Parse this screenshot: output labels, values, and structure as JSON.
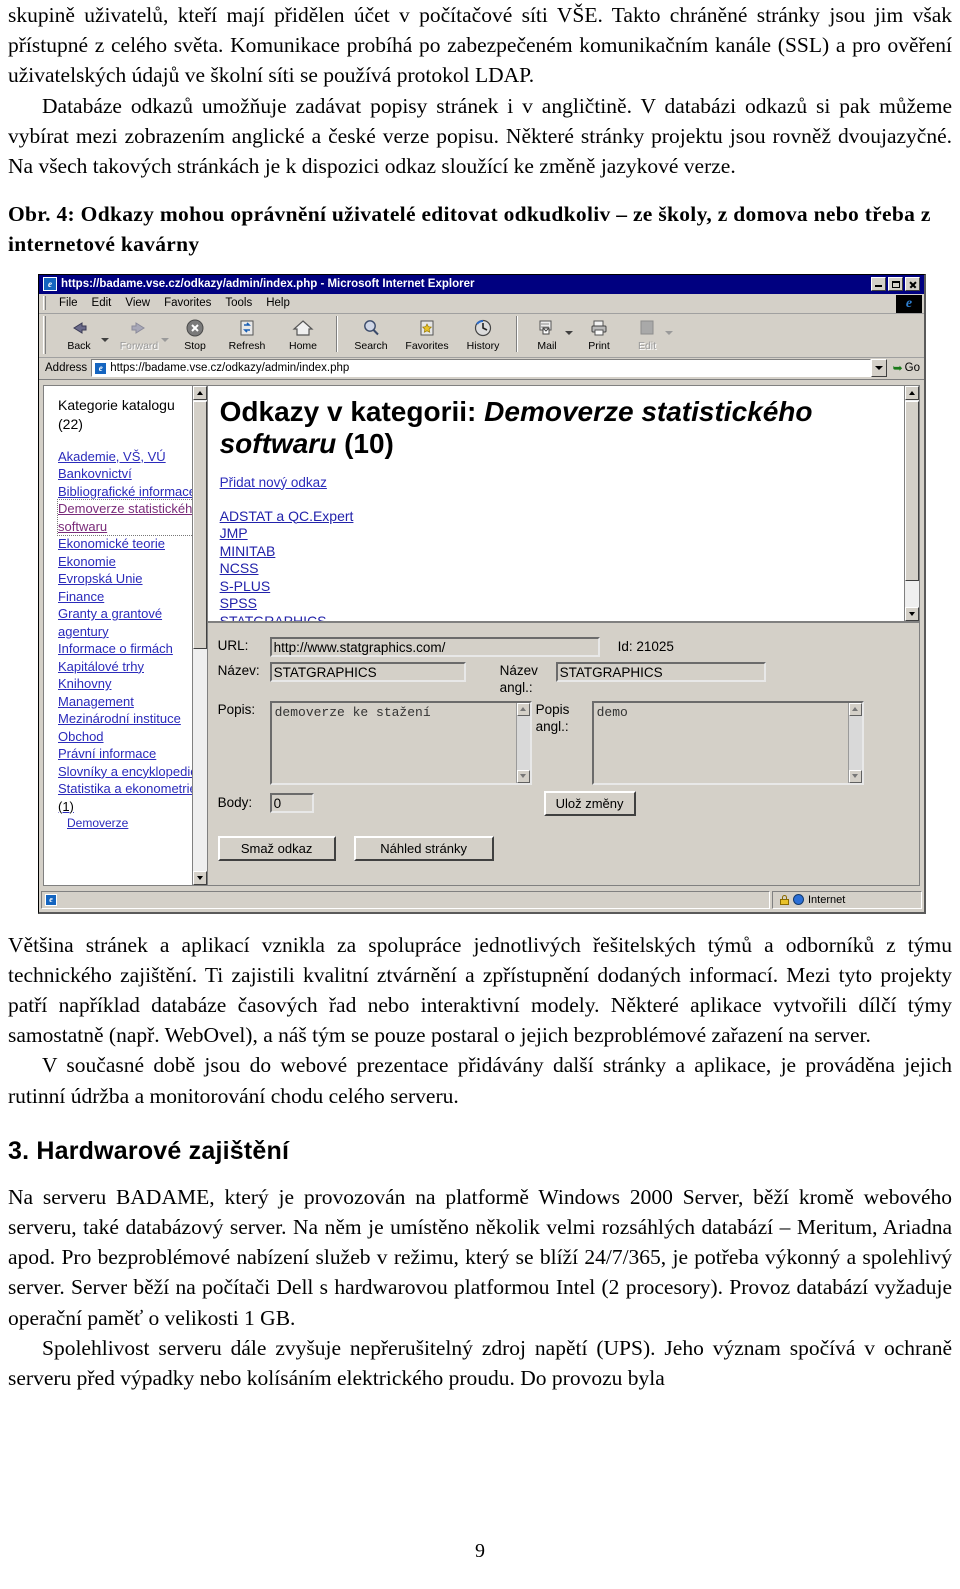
{
  "document": {
    "paragraphs": [
      "skupině uživatelů, kteří mají přidělen účet v počítačové síti VŠE. Takto chráněné stránky jsou jim však přístupné z celého světa. Komunikace probíhá po zabezpečeném komunikačním kanále (SSL) a pro ověření uživatelských údajů ve školní síti se používá protokol LDAP.",
      "Databáze odkazů umožňuje zadávat popisy stránek i v angličtině. V databázi odkazů si pak můžeme vybírat mezi zobrazením anglické a české verze popisu. Některé stránky projektu jsou rovněž dvoujazyčné. Na všech takových stránkách je k dispozici odkaz sloužící ke změně jazykové verze."
    ],
    "figure_caption": "Obr. 4: Odkazy mohou oprávnění uživatelé editovat odkudkoliv – ze školy, z domova nebo třeba z internetové kavárny",
    "paragraphs_after": [
      "Většina stránek a aplikací vznikla za spolupráce jednotlivých řešitelských týmů a odborníků z týmu technického zajištění. Ti zajistili kvalitní ztvárnění a zpřístupnění dodaných informací. Mezi tyto projekty patří například databáze časových řad nebo interaktivní modely. Některé aplikace vytvořili dílčí týmy samostatně (např. WebOvel), a náš tým se pouze postaral o jejich bezproblémové zařazení na server.",
      "V současné době jsou do webové prezentace přidávány další stránky a aplikace, je prováděna jejich rutinní údržba a monitorování chodu celého serveru."
    ],
    "section_heading": "3. Hardwarové zajištění",
    "paragraphs_section": [
      "Na serveru BADAME, který je provozován na platformě Windows 2000 Server, běží kromě webového serveru, také databázový server. Na něm je umístěno několik velmi rozsáhlých databází – Meritum, Ariadna apod. Pro bezproblémové nabízení služeb v režimu, který se blíží 24/7/365, je potřeba výkonný a spolehlivý server. Server běží na počítači Dell s hardwarovou platformou Intel (2 procesory). Provoz databází vyžaduje operační paměť o velikosti 1 GB.",
      "Spolehlivost serveru dále zvyšuje nepřerušitelný zdroj napětí (UPS). Jeho význam spočívá v ochraně serveru před výpadky nebo kolísáním elektrického proudu. Do provozu byla"
    ],
    "page_number": "9"
  },
  "browser": {
    "title": "https://badame.vse.cz/odkazy/admin/index.php - Microsoft Internet Explorer",
    "titlebar_icon": "e",
    "window_buttons": [
      "minimize",
      "maximize",
      "close"
    ],
    "menu": [
      "File",
      "Edit",
      "View",
      "Favorites",
      "Tools",
      "Help"
    ],
    "toolbar": [
      {
        "label": "Back",
        "icon": "back-arrow-icon",
        "dropdown": true,
        "disabled": false
      },
      {
        "label": "Forward",
        "icon": "forward-arrow-icon",
        "dropdown": true,
        "disabled": true
      },
      {
        "label": "Stop",
        "icon": "stop-icon",
        "dropdown": false,
        "disabled": false
      },
      {
        "label": "Refresh",
        "icon": "refresh-icon",
        "dropdown": false,
        "disabled": false
      },
      {
        "label": "Home",
        "icon": "home-icon",
        "dropdown": false,
        "disabled": false
      },
      {
        "label": "Search",
        "icon": "search-icon",
        "dropdown": false,
        "disabled": false
      },
      {
        "label": "Favorites",
        "icon": "favorites-icon",
        "dropdown": false,
        "disabled": false
      },
      {
        "label": "History",
        "icon": "history-icon",
        "dropdown": false,
        "disabled": false
      },
      {
        "label": "Mail",
        "icon": "mail-icon",
        "dropdown": true,
        "disabled": false
      },
      {
        "label": "Print",
        "icon": "print-icon",
        "dropdown": false,
        "disabled": false
      },
      {
        "label": "Edit",
        "icon": "edit-icon",
        "dropdown": true,
        "disabled": true
      }
    ],
    "address": {
      "label": "Address",
      "value": "https://badame.vse.cz/odkazy/admin/index.php",
      "go_label": "Go"
    },
    "statusbar": {
      "message": "",
      "zone": "Internet"
    }
  },
  "sidebar": {
    "title": "Kategorie katalogu (22)",
    "items": [
      {
        "label": "Akademie, VŠ, VÚ",
        "state": "link",
        "count": ""
      },
      {
        "label": "Bankovnictví",
        "state": "link",
        "count": ""
      },
      {
        "label": "Bibliografické informace",
        "state": "link",
        "count": ""
      },
      {
        "label": "Demoverze statistického softwaru",
        "state": "visited-focused",
        "count": ""
      },
      {
        "label": "Ekonomické teorie",
        "state": "link",
        "count": ""
      },
      {
        "label": "Ekonomie",
        "state": "link",
        "count": ""
      },
      {
        "label": "Evropská Unie",
        "state": "link",
        "count": ""
      },
      {
        "label": "Finance",
        "state": "link",
        "count": ""
      },
      {
        "label": "Granty a grantové agentury",
        "state": "link",
        "count": ""
      },
      {
        "label": "Informace o firmách",
        "state": "link",
        "count": ""
      },
      {
        "label": "Kapitálové trhy",
        "state": "link",
        "count": ""
      },
      {
        "label": "Knihovny",
        "state": "link",
        "count": ""
      },
      {
        "label": "Management",
        "state": "link",
        "count": ""
      },
      {
        "label": "Mezinárodní instituce",
        "state": "link",
        "count": ""
      },
      {
        "label": "Obchod",
        "state": "link",
        "count": ""
      },
      {
        "label": "Právní informace",
        "state": "link",
        "count": ""
      },
      {
        "label": "Slovníky a encyklopedie",
        "state": "link",
        "count": ""
      },
      {
        "label": "Statistika a ekonometrie",
        "state": "link",
        "count": " (1)"
      },
      {
        "label": "Demoverze",
        "state": "link-sub",
        "count": ""
      }
    ]
  },
  "main": {
    "heading_prefix": "Odkazy v kategorii: ",
    "heading_category": "Demoverze statistického softwaru",
    "heading_count": " (10)",
    "add_link_label": "Přidat nový odkaz",
    "links": [
      "ADSTAT a QC.Expert",
      "JMP",
      "MINITAB",
      "NCSS",
      "S-PLUS",
      "SPSS",
      "STATGRAPHICS"
    ]
  },
  "form": {
    "url_label": "URL:",
    "url_value": "http://www.statgraphics.com/",
    "id_label": "Id: 21025",
    "name_label": "Název:",
    "name_value": "STATGRAPHICS",
    "name_en_label": "Název angl.:",
    "name_en_value": "STATGRAPHICS",
    "desc_label": "Popis:",
    "desc_value": "demoverze ke stažení",
    "desc_en_label": "Popis angl.:",
    "desc_en_value": "demo",
    "points_label": "Body:",
    "points_value": "0",
    "save_label": "Ulož změny",
    "delete_label": "Smaž odkaz",
    "preview_label": "Náhled stránky"
  },
  "colors": {
    "title_bar": "#000080",
    "chrome": "#d4d0c8",
    "link": "#2222aa",
    "visited_link": "#7a2b7a",
    "page_bg": "#ffffff"
  }
}
